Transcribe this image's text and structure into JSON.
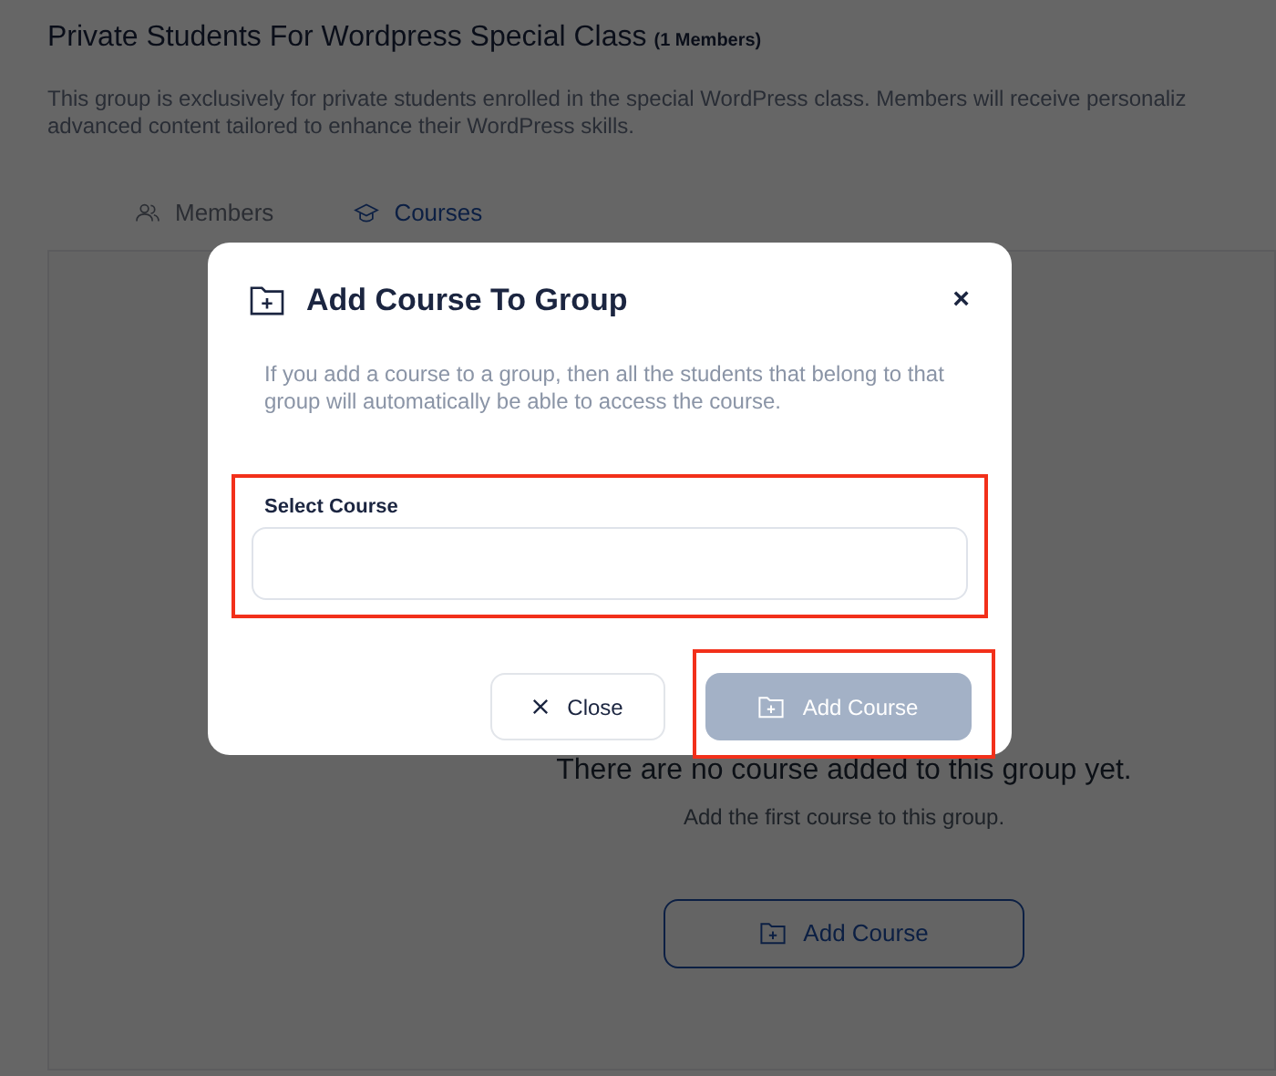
{
  "group": {
    "title": "Private Students For Wordpress Special Class",
    "member_count": "(1 Members)",
    "description_lines": [
      "This group is exclusively for private students enrolled in the special WordPress class. Members will receive personaliz",
      "advanced content tailored to enhance their WordPress skills."
    ]
  },
  "tabs": [
    {
      "label": "Members",
      "kind": "members",
      "selected": false
    },
    {
      "label": "Courses",
      "kind": "courses",
      "selected": true
    }
  ],
  "empty_state": {
    "title": "There are no course added to this group yet.",
    "subtitle": "Add the first course to this group.",
    "button": "Add Course"
  },
  "modal": {
    "title": "Add Course To Group",
    "close_icon": "×",
    "description": "If you add a course to a group, then all the students that belong to that group will automatically be able to access the course.",
    "field": {
      "label": "Select Course",
      "highlighted": true
    },
    "buttons": [
      {
        "label": "Close",
        "kind": "secondary",
        "disabled": false,
        "highlighted": false
      },
      {
        "label": "Add Course",
        "kind": "primary",
        "disabled": true,
        "highlighted": true
      }
    ]
  }
}
